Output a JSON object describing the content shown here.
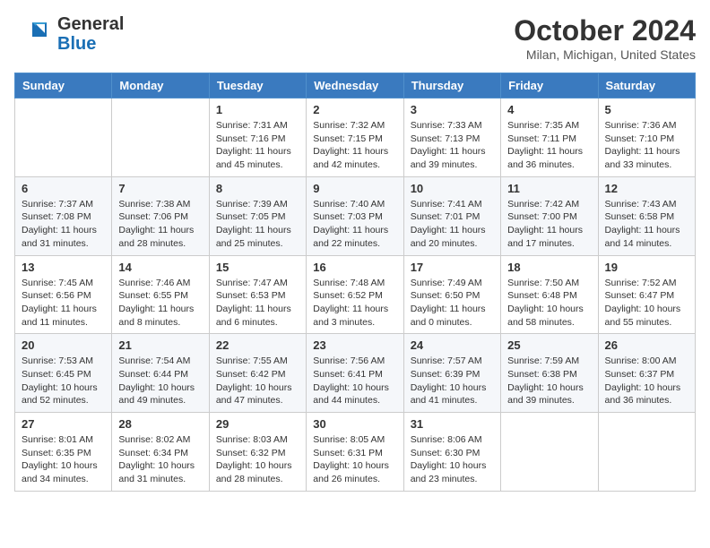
{
  "header": {
    "logo_line1": "General",
    "logo_line2": "Blue",
    "month": "October 2024",
    "location": "Milan, Michigan, United States"
  },
  "weekdays": [
    "Sunday",
    "Monday",
    "Tuesday",
    "Wednesday",
    "Thursday",
    "Friday",
    "Saturday"
  ],
  "weeks": [
    [
      {
        "day": "",
        "info": ""
      },
      {
        "day": "",
        "info": ""
      },
      {
        "day": "1",
        "info": "Sunrise: 7:31 AM\nSunset: 7:16 PM\nDaylight: 11 hours and 45 minutes."
      },
      {
        "day": "2",
        "info": "Sunrise: 7:32 AM\nSunset: 7:15 PM\nDaylight: 11 hours and 42 minutes."
      },
      {
        "day": "3",
        "info": "Sunrise: 7:33 AM\nSunset: 7:13 PM\nDaylight: 11 hours and 39 minutes."
      },
      {
        "day": "4",
        "info": "Sunrise: 7:35 AM\nSunset: 7:11 PM\nDaylight: 11 hours and 36 minutes."
      },
      {
        "day": "5",
        "info": "Sunrise: 7:36 AM\nSunset: 7:10 PM\nDaylight: 11 hours and 33 minutes."
      }
    ],
    [
      {
        "day": "6",
        "info": "Sunrise: 7:37 AM\nSunset: 7:08 PM\nDaylight: 11 hours and 31 minutes."
      },
      {
        "day": "7",
        "info": "Sunrise: 7:38 AM\nSunset: 7:06 PM\nDaylight: 11 hours and 28 minutes."
      },
      {
        "day": "8",
        "info": "Sunrise: 7:39 AM\nSunset: 7:05 PM\nDaylight: 11 hours and 25 minutes."
      },
      {
        "day": "9",
        "info": "Sunrise: 7:40 AM\nSunset: 7:03 PM\nDaylight: 11 hours and 22 minutes."
      },
      {
        "day": "10",
        "info": "Sunrise: 7:41 AM\nSunset: 7:01 PM\nDaylight: 11 hours and 20 minutes."
      },
      {
        "day": "11",
        "info": "Sunrise: 7:42 AM\nSunset: 7:00 PM\nDaylight: 11 hours and 17 minutes."
      },
      {
        "day": "12",
        "info": "Sunrise: 7:43 AM\nSunset: 6:58 PM\nDaylight: 11 hours and 14 minutes."
      }
    ],
    [
      {
        "day": "13",
        "info": "Sunrise: 7:45 AM\nSunset: 6:56 PM\nDaylight: 11 hours and 11 minutes."
      },
      {
        "day": "14",
        "info": "Sunrise: 7:46 AM\nSunset: 6:55 PM\nDaylight: 11 hours and 8 minutes."
      },
      {
        "day": "15",
        "info": "Sunrise: 7:47 AM\nSunset: 6:53 PM\nDaylight: 11 hours and 6 minutes."
      },
      {
        "day": "16",
        "info": "Sunrise: 7:48 AM\nSunset: 6:52 PM\nDaylight: 11 hours and 3 minutes."
      },
      {
        "day": "17",
        "info": "Sunrise: 7:49 AM\nSunset: 6:50 PM\nDaylight: 11 hours and 0 minutes."
      },
      {
        "day": "18",
        "info": "Sunrise: 7:50 AM\nSunset: 6:48 PM\nDaylight: 10 hours and 58 minutes."
      },
      {
        "day": "19",
        "info": "Sunrise: 7:52 AM\nSunset: 6:47 PM\nDaylight: 10 hours and 55 minutes."
      }
    ],
    [
      {
        "day": "20",
        "info": "Sunrise: 7:53 AM\nSunset: 6:45 PM\nDaylight: 10 hours and 52 minutes."
      },
      {
        "day": "21",
        "info": "Sunrise: 7:54 AM\nSunset: 6:44 PM\nDaylight: 10 hours and 49 minutes."
      },
      {
        "day": "22",
        "info": "Sunrise: 7:55 AM\nSunset: 6:42 PM\nDaylight: 10 hours and 47 minutes."
      },
      {
        "day": "23",
        "info": "Sunrise: 7:56 AM\nSunset: 6:41 PM\nDaylight: 10 hours and 44 minutes."
      },
      {
        "day": "24",
        "info": "Sunrise: 7:57 AM\nSunset: 6:39 PM\nDaylight: 10 hours and 41 minutes."
      },
      {
        "day": "25",
        "info": "Sunrise: 7:59 AM\nSunset: 6:38 PM\nDaylight: 10 hours and 39 minutes."
      },
      {
        "day": "26",
        "info": "Sunrise: 8:00 AM\nSunset: 6:37 PM\nDaylight: 10 hours and 36 minutes."
      }
    ],
    [
      {
        "day": "27",
        "info": "Sunrise: 8:01 AM\nSunset: 6:35 PM\nDaylight: 10 hours and 34 minutes."
      },
      {
        "day": "28",
        "info": "Sunrise: 8:02 AM\nSunset: 6:34 PM\nDaylight: 10 hours and 31 minutes."
      },
      {
        "day": "29",
        "info": "Sunrise: 8:03 AM\nSunset: 6:32 PM\nDaylight: 10 hours and 28 minutes."
      },
      {
        "day": "30",
        "info": "Sunrise: 8:05 AM\nSunset: 6:31 PM\nDaylight: 10 hours and 26 minutes."
      },
      {
        "day": "31",
        "info": "Sunrise: 8:06 AM\nSunset: 6:30 PM\nDaylight: 10 hours and 23 minutes."
      },
      {
        "day": "",
        "info": ""
      },
      {
        "day": "",
        "info": ""
      }
    ]
  ]
}
